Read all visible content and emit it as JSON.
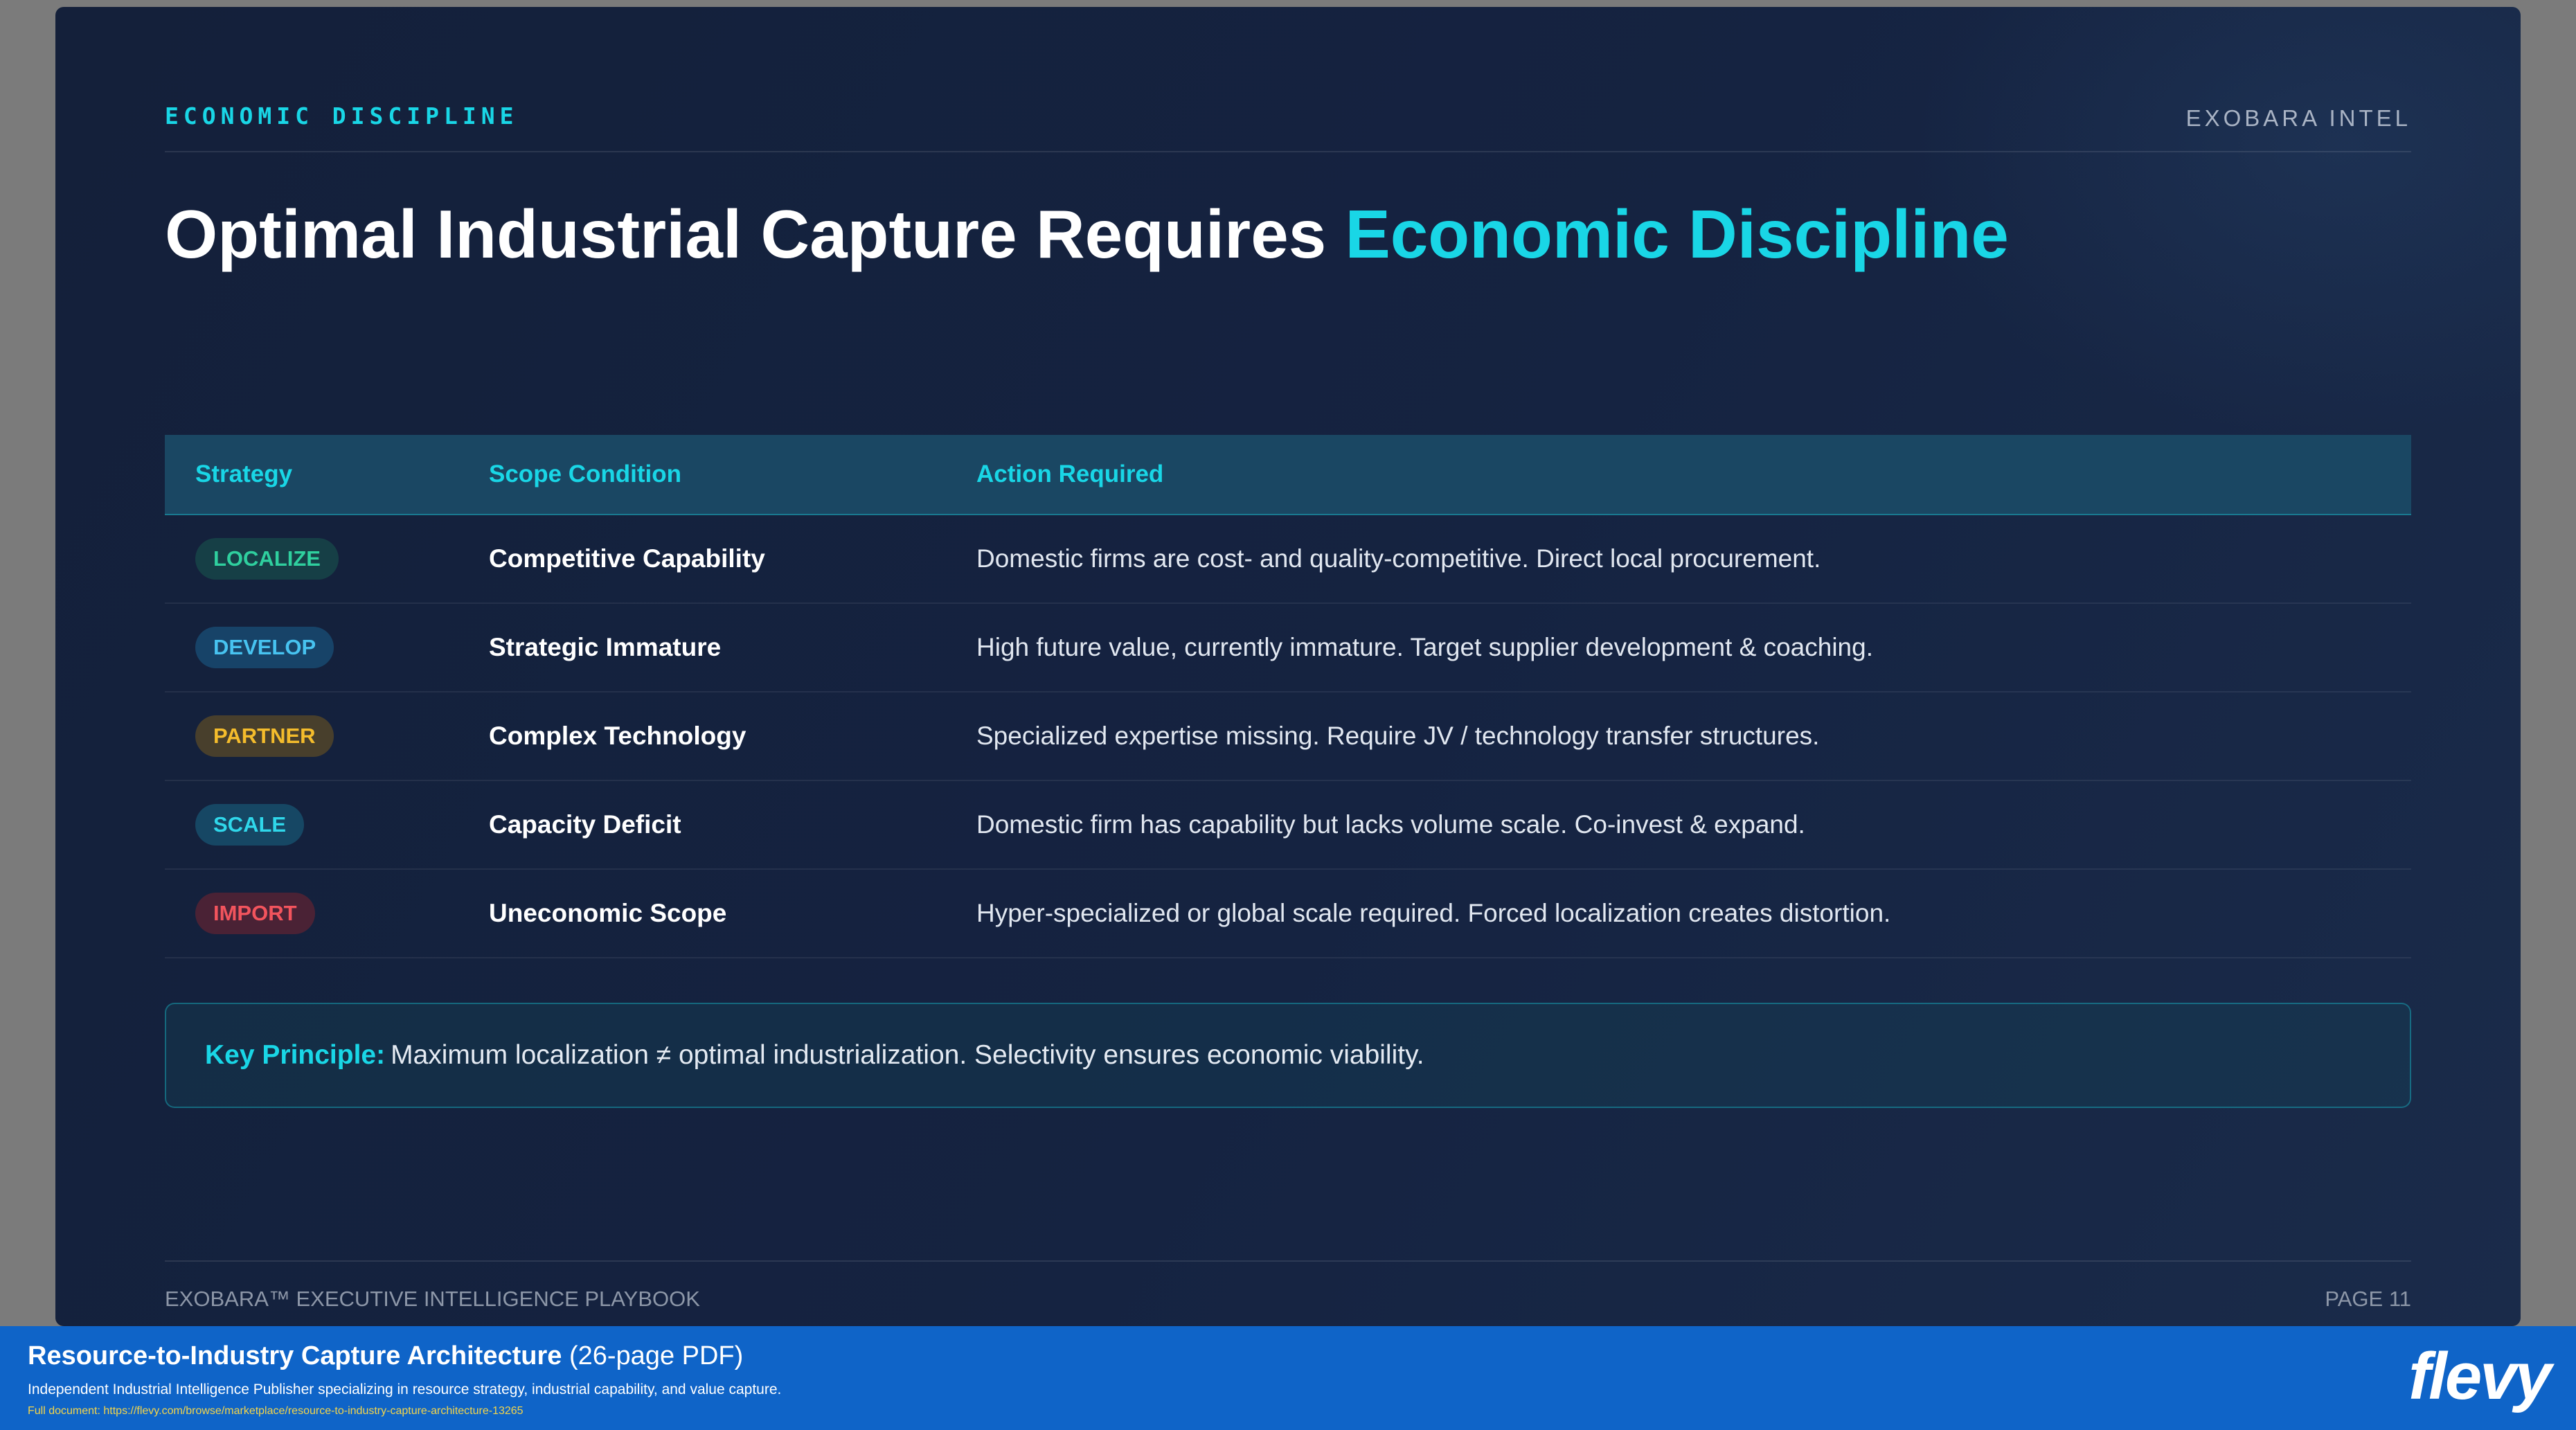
{
  "slide": {
    "eyebrow": "ECONOMIC DISCIPLINE",
    "brand": "EXOBARA INTEL",
    "title_main": "Optimal Industrial Capture Requires ",
    "title_accent": "Economic Discipline"
  },
  "table": {
    "headers": [
      "Strategy",
      "Scope Condition",
      "Action Required"
    ],
    "rows": [
      {
        "strategy": "LOCALIZE",
        "scope": "Competitive Capability",
        "action": "Domestic firms are cost- and quality-competitive. Direct local procurement."
      },
      {
        "strategy": "DEVELOP",
        "scope": "Strategic Immature",
        "action": "High future value, currently immature. Target supplier development & coaching."
      },
      {
        "strategy": "PARTNER",
        "scope": "Complex Technology",
        "action": "Specialized expertise missing. Require JV / technology transfer structures."
      },
      {
        "strategy": "SCALE",
        "scope": "Capacity Deficit",
        "action": "Domestic firm has capability but lacks volume scale. Co-invest & expand."
      },
      {
        "strategy": "IMPORT",
        "scope": "Uneconomic Scope",
        "action": "Hyper-specialized or global scale required. Forced localization creates distortion."
      }
    ]
  },
  "principle": {
    "key": "Key Principle:",
    "text": "Maximum localization ≠ optimal industrialization. Selectivity ensures economic viability."
  },
  "footer": {
    "left": "EXOBARA™ EXECUTIVE INTELLIGENCE PLAYBOOK",
    "right": "PAGE 11"
  },
  "banner": {
    "title": "Resource-to-Industry Capture Architecture",
    "title_suffix": "(26-page PDF)",
    "subtitle": "Independent Industrial Intelligence Publisher specializing in resource strategy, industrial capability, and value capture.",
    "url": "Full document: https://flevy.com/browse/marketplace/resource-to-industry-capture-architecture-13265",
    "logo": "flevy"
  },
  "colors": {
    "accent": "#19d6e6",
    "slide_bg": "#152341",
    "banner_bg": "#0f64c8"
  }
}
